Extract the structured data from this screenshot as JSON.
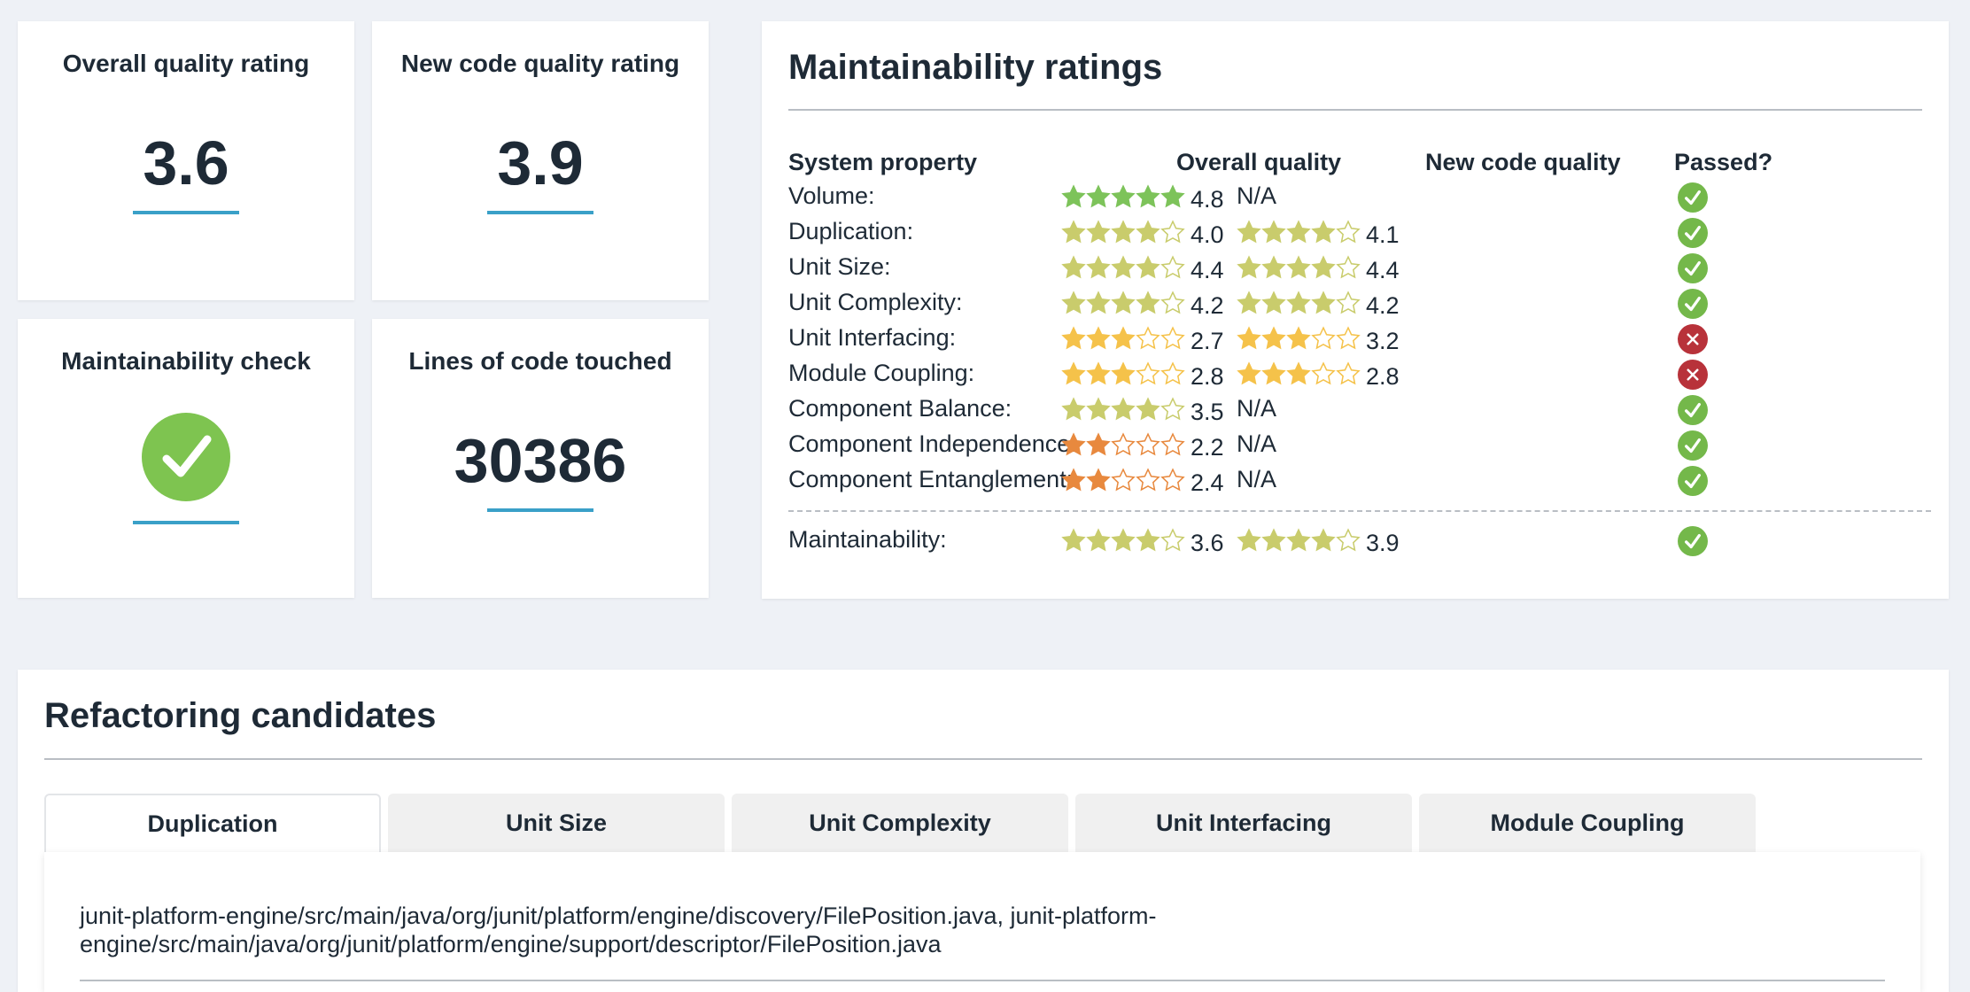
{
  "metrics": {
    "overall_quality": {
      "title": "Overall quality rating",
      "value": "3.6"
    },
    "new_code_quality": {
      "title": "New code quality rating",
      "value": "3.9"
    },
    "maintainability_check": {
      "title": "Maintainability check",
      "icon": "check-icon",
      "status": "passed"
    },
    "lines_touched": {
      "title": "Lines of code touched",
      "value": "30386"
    }
  },
  "ratings": {
    "title": "Maintainability ratings",
    "headers": {
      "property": "System property",
      "overall": "Overall quality",
      "new_code": "New code quality",
      "passed": "Passed?"
    },
    "rows": [
      {
        "label": "Volume:",
        "overall": "4.8",
        "new_code": "N/A",
        "passed": true
      },
      {
        "label": "Duplication:",
        "overall": "4.0",
        "new_code": "4.1",
        "passed": true
      },
      {
        "label": "Unit Size:",
        "overall": "4.4",
        "new_code": "4.4",
        "passed": true
      },
      {
        "label": "Unit Complexity:",
        "overall": "4.2",
        "new_code": "4.2",
        "passed": true
      },
      {
        "label": "Unit Interfacing:",
        "overall": "2.7",
        "new_code": "3.2",
        "passed": false
      },
      {
        "label": "Module Coupling:",
        "overall": "2.8",
        "new_code": "2.8",
        "passed": false
      },
      {
        "label": "Component Balance:",
        "overall": "3.5",
        "new_code": "N/A",
        "passed": true
      },
      {
        "label": "Component Independence:",
        "overall": "2.2",
        "new_code": "N/A",
        "passed": true
      },
      {
        "label": "Component Entanglement:",
        "overall": "2.4",
        "new_code": "N/A",
        "passed": true
      }
    ],
    "total": {
      "label": "Maintainability:",
      "overall": "3.6",
      "new_code": "3.9",
      "passed": true
    },
    "star_colors": {
      "high": "#7dc35a",
      "good": "#c9cc6c",
      "mid": "#f5c24a",
      "low": "#e8893e"
    }
  },
  "refactoring": {
    "title": "Refactoring candidates",
    "tabs": [
      "Duplication",
      "Unit Size",
      "Unit Complexity",
      "Unit Interfacing",
      "Module Coupling"
    ],
    "active_tab": 0,
    "candidate_line1": "junit-platform-engine/src/main/java/org/junit/platform/engine/discovery/FilePosition.java, junit-platform-",
    "candidate_line2": "engine/src/main/java/org/junit/platform/engine/support/descriptor/FilePosition.java"
  }
}
